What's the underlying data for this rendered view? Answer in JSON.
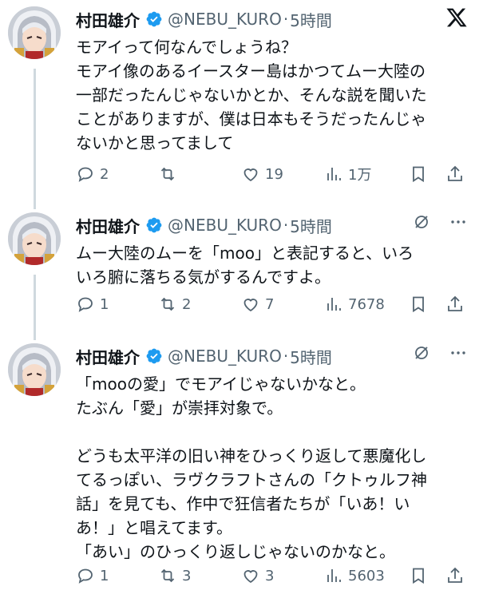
{
  "author": {
    "name": "村田雄介",
    "handle": "@NEBU_KURO",
    "separator": "·"
  },
  "colors": {
    "verified": "#1d9bf0",
    "muted": "#536471",
    "line": "#cfd9de"
  },
  "tweets": [
    {
      "time": "5時間",
      "text": "モアイって何なんでしょうね？\nモアイ像のあるイースター島はかつてムー大陸の\n一部だったんじゃないかとか、そんな説を聞いた\nことがありますが、僕は日本もそうだったんじゃ\nないかと思ってまして",
      "replies": "2",
      "retweets": "",
      "likes": "19",
      "views": "1万"
    },
    {
      "time": "5時間",
      "text": "ムー大陸のムーを「moo」と表記すると、いろ\nいろ腑に落ちる気がするんですよ。",
      "replies": "1",
      "retweets": "2",
      "likes": "7",
      "views": "7678"
    },
    {
      "time": "5時間",
      "text": "「mooの愛」でモアイじゃないかなと。\nたぶん「愛」が崇拝対象で。\n\nどうも太平洋の旧い神をひっくり返して悪魔化し\nてるっぽい、ラヴクラフトさんの「クトゥルフ神\n話」を見ても、作中で狂信者たちが「いあ！い\nあ！」と唱えてます。\n「あい」のひっくり返しじゃないのかなと。",
      "replies": "1",
      "retweets": "3",
      "likes": "3",
      "views": "5603"
    }
  ],
  "icons": {
    "x_logo": "x-logo-icon",
    "grok": "grok-icon",
    "more": "more-icon",
    "reply": "reply-icon",
    "retweet": "retweet-icon",
    "like": "heart-icon",
    "views": "views-icon",
    "bookmark": "bookmark-icon",
    "share": "share-icon"
  }
}
